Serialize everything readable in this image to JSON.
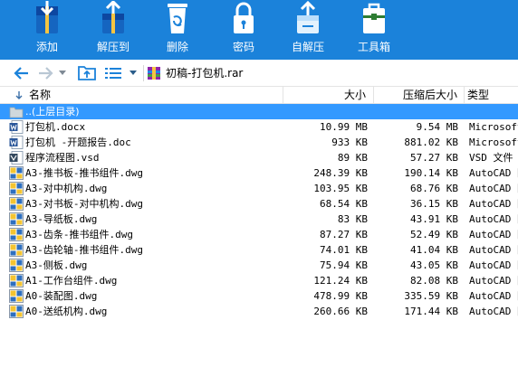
{
  "toolbar": {
    "buttons": [
      {
        "label": "添加",
        "icon": "add-archive-icon"
      },
      {
        "label": "解压到",
        "icon": "extract-to-icon"
      },
      {
        "label": "删除",
        "icon": "recycle-bin-icon"
      },
      {
        "label": "密码",
        "icon": "padlock-icon"
      },
      {
        "label": "自解压",
        "icon": "self-extract-icon"
      },
      {
        "label": "工具箱",
        "icon": "toolbox-icon"
      }
    ]
  },
  "address": {
    "path": "初稿-打包机.rar"
  },
  "columns": {
    "name": "名称",
    "size": "大小",
    "packed": "压缩后大小",
    "type": "类型"
  },
  "parent_row": {
    "label": "..(上层目录)"
  },
  "files": [
    {
      "name": "打包机.docx",
      "size": "10.99 MB",
      "packed": "9.54 MB",
      "type": "Microsoft",
      "icon": "word-icon"
    },
    {
      "name": "打包机 -开题报告.doc",
      "size": "933 KB",
      "packed": "881.02 KB",
      "type": "Microsoft",
      "icon": "word-icon"
    },
    {
      "name": "程序流程图.vsd",
      "size": "89 KB",
      "packed": "57.27 KB",
      "type": "VSD 文件",
      "icon": "visio-icon"
    },
    {
      "name": "A3-推书板-推书组件.dwg",
      "size": "248.39 KB",
      "packed": "190.14 KB",
      "type": "AutoCAD 图",
      "icon": "dwg-icon"
    },
    {
      "name": "A3-对中机构.dwg",
      "size": "103.95 KB",
      "packed": "68.76 KB",
      "type": "AutoCAD 图",
      "icon": "dwg-icon"
    },
    {
      "name": "A3-对书板-对中机构.dwg",
      "size": "68.54 KB",
      "packed": "36.15 KB",
      "type": "AutoCAD 图",
      "icon": "dwg-icon"
    },
    {
      "name": "A3-导纸板.dwg",
      "size": "83 KB",
      "packed": "43.91 KB",
      "type": "AutoCAD 图",
      "icon": "dwg-icon"
    },
    {
      "name": "A3-齿条-推书组件.dwg",
      "size": "87.27 KB",
      "packed": "52.49 KB",
      "type": "AutoCAD 图",
      "icon": "dwg-icon"
    },
    {
      "name": "A3-齿轮轴-推书组件.dwg",
      "size": "74.01 KB",
      "packed": "41.04 KB",
      "type": "AutoCAD 图",
      "icon": "dwg-icon"
    },
    {
      "name": "A3-侧板.dwg",
      "size": "75.94 KB",
      "packed": "43.05 KB",
      "type": "AutoCAD 图",
      "icon": "dwg-icon"
    },
    {
      "name": "A1-工作台组件.dwg",
      "size": "121.24 KB",
      "packed": "82.08 KB",
      "type": "AutoCAD 图",
      "icon": "dwg-icon"
    },
    {
      "name": "A0-装配图.dwg",
      "size": "478.99 KB",
      "packed": "335.59 KB",
      "type": "AutoCAD 图",
      "icon": "dwg-icon"
    },
    {
      "name": "A0-送纸机构.dwg",
      "size": "260.66 KB",
      "packed": "171.44 KB",
      "type": "AutoCAD 图",
      "icon": "dwg-icon"
    }
  ],
  "colors": {
    "toolbar_bg": "#1b82da",
    "selection_bg": "#3399ff",
    "nav_arrow": "#1b82da"
  }
}
